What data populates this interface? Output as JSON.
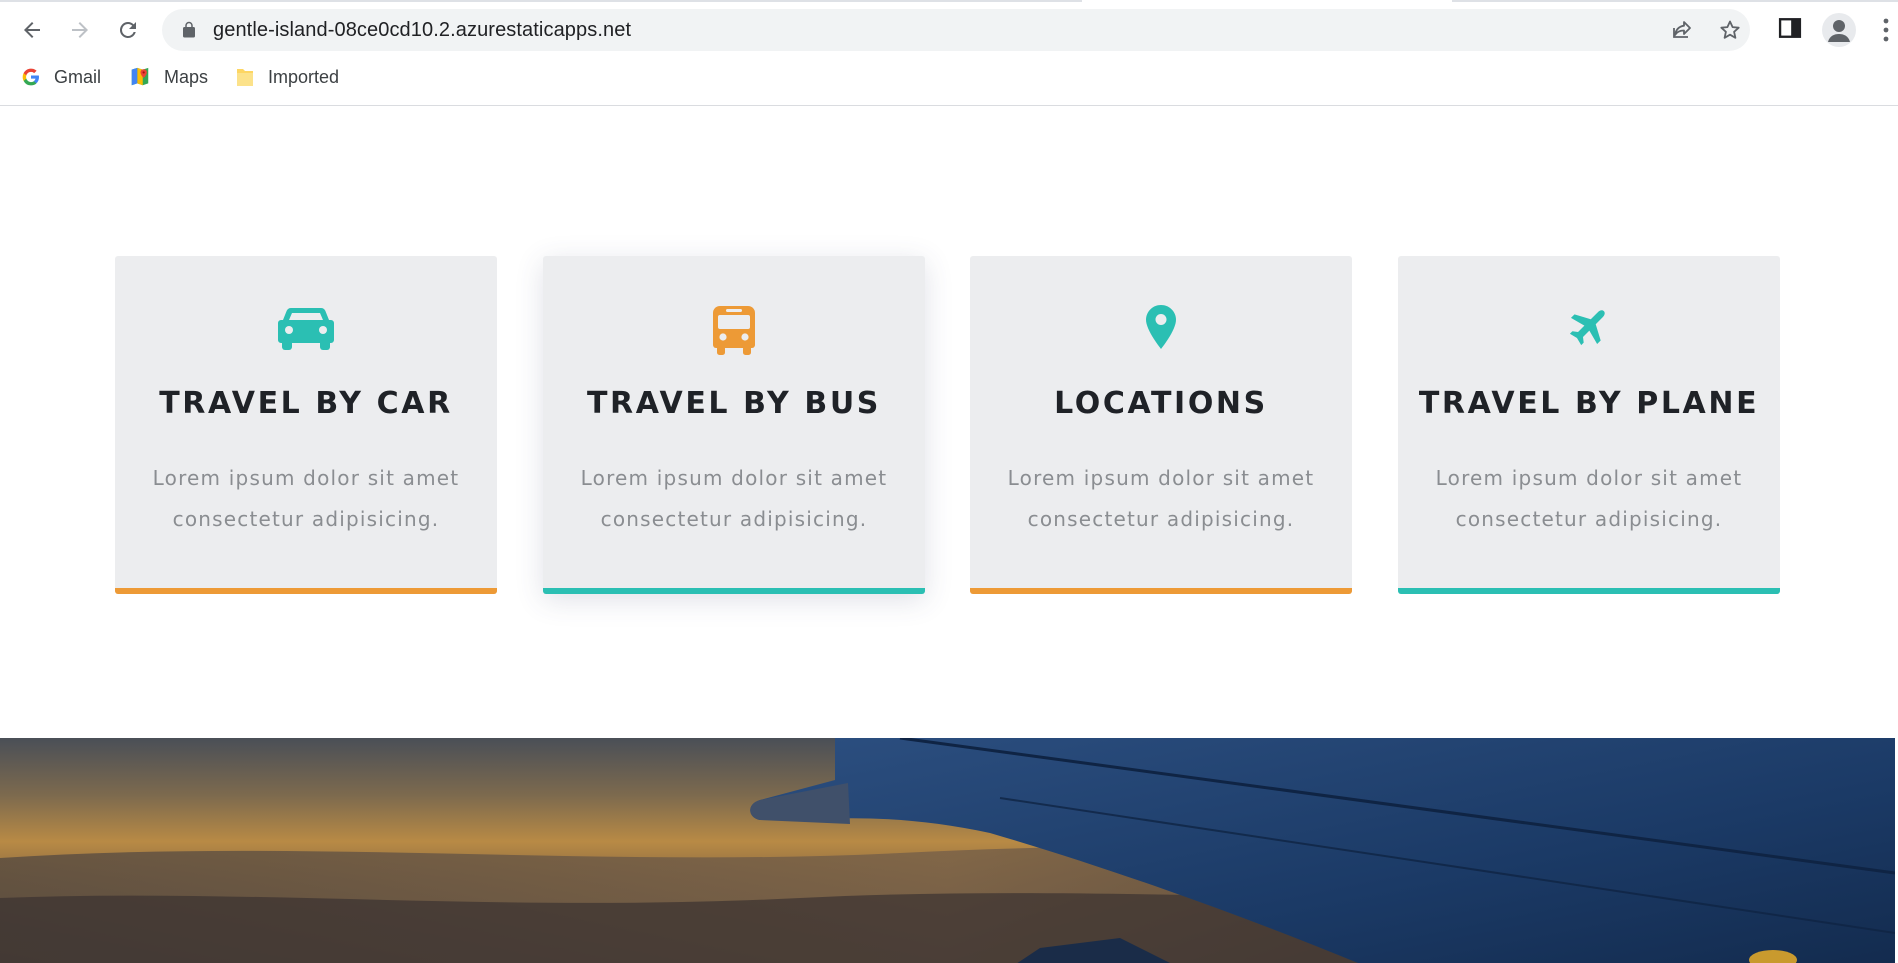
{
  "browser": {
    "url": "gentle-island-08ce0cd10.2.azurestaticapps.net",
    "nav": {
      "back": "back-arrow-icon",
      "forward": "forward-arrow-icon",
      "reload": "reload-icon"
    },
    "bookmarks": [
      {
        "label": "Gmail",
        "icon": "google-icon"
      },
      {
        "label": "Maps",
        "icon": "maps-icon"
      },
      {
        "label": "Imported",
        "icon": "folder-icon"
      }
    ]
  },
  "colors": {
    "orange": "#ed9a36",
    "teal": "#2bbfb3",
    "card_bg": "#ecedef",
    "title": "#1f2227",
    "body_text": "#8a8d91"
  },
  "services": [
    {
      "icon": "car-icon",
      "title": "TRAVEL BY CAR",
      "line1": "Lorem ipsum dolor sit amet",
      "line2": "consectetur adipisicing.",
      "icon_color": "#2bbfb3",
      "bar_color": "#ed9a36"
    },
    {
      "icon": "bus-icon",
      "title": "TRAVEL BY BUS",
      "line1": "Lorem ipsum dolor sit amet",
      "line2": "consectetur adipisicing.",
      "icon_color": "#ed9a36",
      "bar_color": "#2bbfb3"
    },
    {
      "icon": "map-marker-icon",
      "title": "LOCATIONS",
      "line1": "Lorem ipsum dolor sit amet",
      "line2": "consectetur adipisicing.",
      "icon_color": "#2bbfb3",
      "bar_color": "#ed9a36"
    },
    {
      "icon": "plane-icon",
      "title": "TRAVEL BY PLANE",
      "line1": "Lorem ipsum dolor sit amet",
      "line2": "consectetur adipisicing.",
      "icon_color": "#2bbfb3",
      "bar_color": "#2bbfb3"
    }
  ]
}
